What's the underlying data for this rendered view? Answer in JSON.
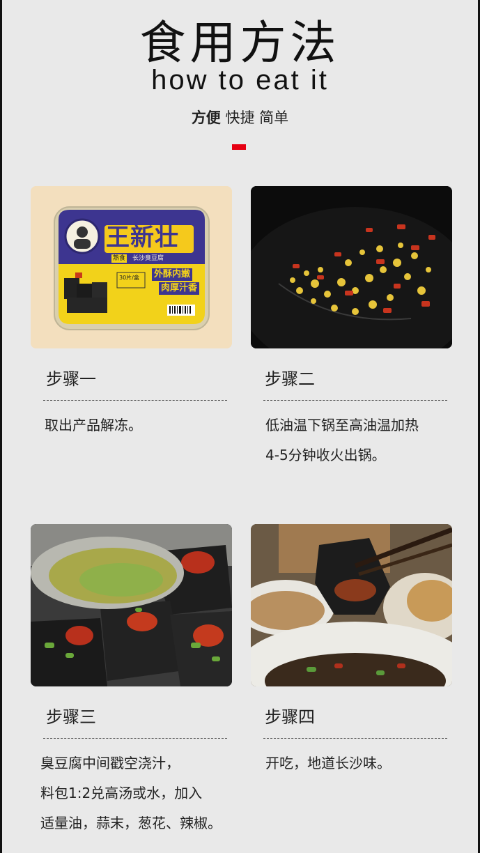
{
  "header": {
    "title_cn": "食用方法",
    "title_en": "how to eat it",
    "tagline_bold": "方便",
    "tagline_rest": "快捷 简单"
  },
  "colors": {
    "accent": "#e60012",
    "background": "#e9e9e9"
  },
  "package": {
    "brand": "王新壮",
    "label_cooked": "熟食",
    "label_product": "长沙臭豆腐",
    "slogan_line1": "外酥内嫩",
    "slogan_line2": "肉厚汁香",
    "count": "30片/盒"
  },
  "steps": [
    {
      "title": "步骤一",
      "desc": "取出产品解冻。"
    },
    {
      "title": "步骤二",
      "desc": "低油温下锅至高油温加热\n4-5分钟收火出锅。"
    },
    {
      "title": "步骤三",
      "desc": "臭豆腐中间戳空浇汁，\n料包1:2兑高汤或水，加入\n适量油，蒜末，葱花、辣椒。"
    },
    {
      "title": "步骤四",
      "desc": "开吃，地道长沙味。"
    }
  ]
}
